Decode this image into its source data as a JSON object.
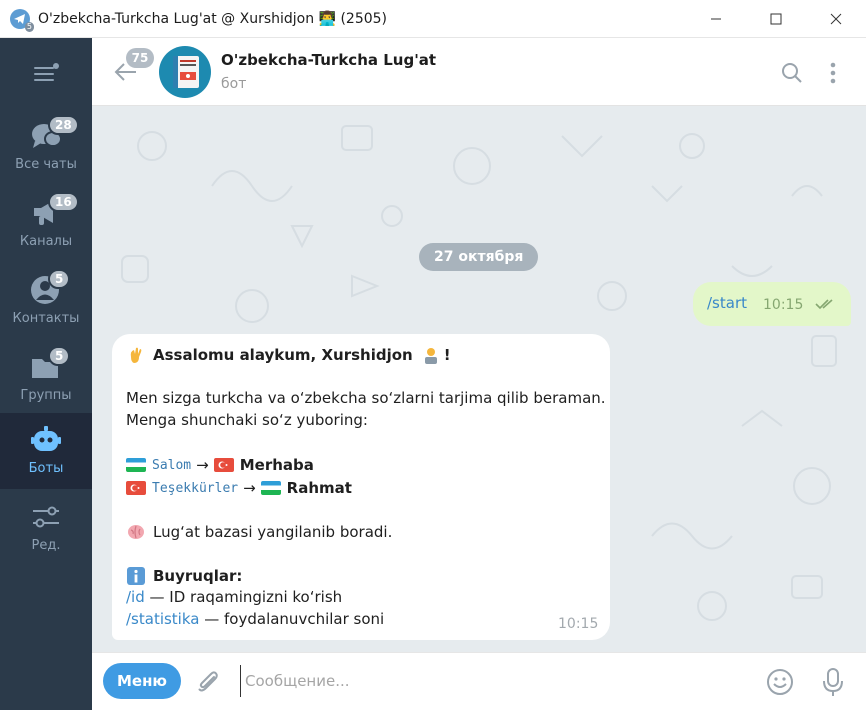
{
  "window": {
    "title": "O'zbekcha-Turkcha Lug'at @ Xurshidjon 👨‍💻 (2505)",
    "app_badge": "5"
  },
  "sidebar": {
    "menu_icon": "hamburger-icon",
    "folders": [
      {
        "label": "Все чаты",
        "count": "28",
        "icon": "chats-icon"
      },
      {
        "label": "Каналы",
        "count": "16",
        "icon": "megaphone-icon"
      },
      {
        "label": "Контакты",
        "count": "5",
        "icon": "contact-icon"
      },
      {
        "label": "Группы",
        "count": "5",
        "icon": "folder-icon"
      },
      {
        "label": "Боты",
        "count": "",
        "icon": "bot-icon",
        "active": true
      },
      {
        "label": "Ред.",
        "count": "",
        "icon": "sliders-icon"
      }
    ]
  },
  "header": {
    "back_count": "75",
    "name": "O'zbekcha-Turkcha Lug'at",
    "status": "бот"
  },
  "messages": {
    "date": "27 октября",
    "outgoing": {
      "text": "/start",
      "time": "10:15",
      "read": true
    },
    "incoming": {
      "greeting": "Assalomu alaykum, Xurshidjon",
      "greeting_end": "!",
      "intro_1": "Men sizga turkcha va o‘zbekcha so‘zlarni tarjima qilib beraman.",
      "intro_2": "Menga shunchaki so‘z yuboring:",
      "example_1_src": "Salom",
      "example_1_arrow": "→",
      "example_1_dst": "Merhaba",
      "example_2_src": "Teşekkürler",
      "example_2_arrow": "→",
      "example_2_dst": "Rahmat",
      "update_note": "Lug‘at bazasi yangilanib boradi.",
      "commands_title": "Buyruqlar:",
      "cmd_id": "/id",
      "cmd_id_desc": " — ID raqamingizni ko‘rish",
      "cmd_stats": "/statistika",
      "cmd_stats_desc": " — foydalanuvchilar soni",
      "time": "10:15"
    }
  },
  "composer": {
    "menu_label": "Меню",
    "placeholder": "Сообщение..."
  },
  "colors": {
    "sidebar_bg": "#2b3a4a",
    "sidebar_active": "#20293a",
    "accent": "#3f9be3",
    "chat_bg": "#e6ebee",
    "outgoing_bubble": "#e3f7c9"
  }
}
